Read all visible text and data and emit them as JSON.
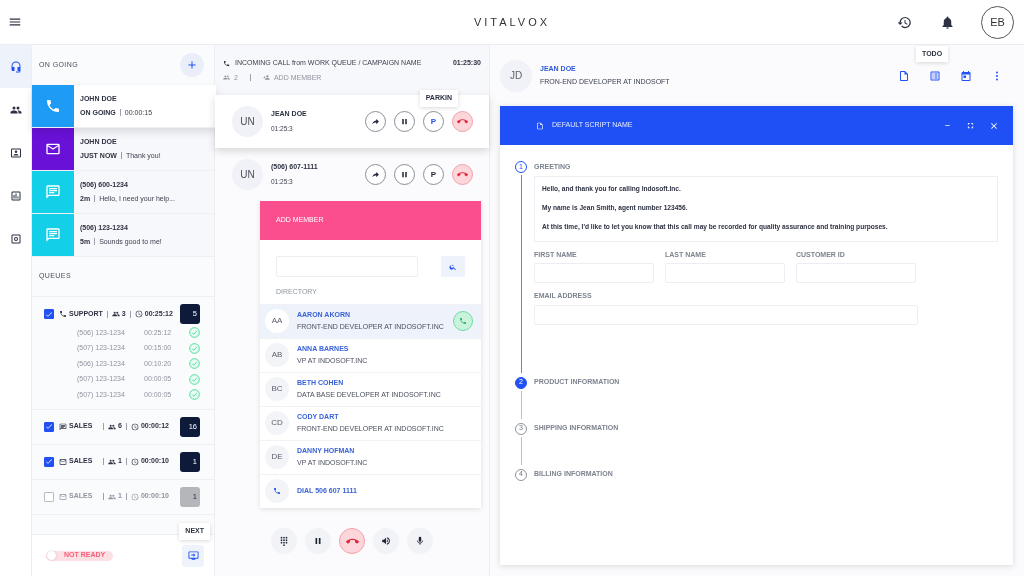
{
  "app": {
    "title": "VITALVOX",
    "avatar": "EB"
  },
  "rail": [
    {
      "selected": true
    },
    {
      "selected": false
    },
    {
      "selected": false
    },
    {
      "selected": false
    },
    {
      "selected": false
    }
  ],
  "ongoing": {
    "title": "ON GOING",
    "items": [
      {
        "kind": "call",
        "name": "JOHN DOE",
        "status": "ON GOING",
        "detail": "00:00:15",
        "color": "#1e9bf5",
        "selected": true
      },
      {
        "kind": "email",
        "name": "JOHN DOE",
        "status": "JUST NOW",
        "detail": "Thank you!",
        "color": "#6a11d8",
        "selected": false
      },
      {
        "kind": "chat",
        "name": "(506) 600-1234",
        "status": "2m",
        "detail": "Hello, I need your help...",
        "color": "#14cfe8",
        "selected": false
      },
      {
        "kind": "chat",
        "name": "(506) 123-1234",
        "status": "5m",
        "detail": "Sounds good to me!",
        "color": "#14cfe8",
        "selected": false
      }
    ]
  },
  "queues": {
    "title": "QUEUES",
    "items": [
      {
        "kind": "call",
        "name": "SUPPORT",
        "agents": "3",
        "time": "00:25:12",
        "count": "5",
        "checked": true,
        "calls": [
          {
            "number": "(506) 123-1234",
            "time": "00:25:12"
          },
          {
            "number": "(507) 123-1234",
            "time": "00:15:00"
          },
          {
            "number": "(506) 123-1234",
            "time": "00:10:20"
          },
          {
            "number": "(507) 123-1234",
            "time": "00:00:05"
          },
          {
            "number": "(507) 123-1234",
            "time": "00:00:05"
          }
        ]
      },
      {
        "kind": "chat",
        "name": "SALES",
        "agents": "6",
        "time": "00:00:12",
        "count": "16",
        "checked": true
      },
      {
        "kind": "email",
        "name": "SALES",
        "agents": "1",
        "time": "00:00:10",
        "count": "1",
        "checked": true
      },
      {
        "kind": "email",
        "name": "SALES",
        "agents": "1",
        "time": "00:00:10",
        "count": "1",
        "checked": false
      }
    ]
  },
  "footer": {
    "status": "NOT READY",
    "on": false,
    "next_tooltip": "NEXT"
  },
  "call": {
    "title": "INCOMING CALL from WORK QUEUE / CAMPAIGN NAME",
    "time": "01:25:30",
    "participants": "2",
    "add_member": "ADD MEMBER",
    "park_tooltip": "PARKIN",
    "lines": [
      {
        "avatar": "UN",
        "name": "JEAN DOE",
        "time": "01:25:3",
        "park": "P",
        "selected": true
      },
      {
        "avatar": "UN",
        "name": "(506) 607-1111",
        "time": "01:25:3",
        "park": "P",
        "selected": false
      }
    ]
  },
  "add_member": {
    "title": "ADD MEMBER",
    "directory_label": "DIRECTORY",
    "contacts": [
      {
        "initials": "AA",
        "name": "AARON AKORN",
        "role": "FRONT-END DEVELOPER AT INDOSOFT.INC",
        "selected": true
      },
      {
        "initials": "AB",
        "name": "ANNA BARNES",
        "role": "VP AT INDOSOFT.INC",
        "selected": false
      },
      {
        "initials": "BC",
        "name": "BETH COHEN",
        "role": "DATA BASE DEVELOPER AT INDOSOFT.INC",
        "selected": false
      },
      {
        "initials": "CD",
        "name": "CODY DART",
        "role": "FRONT-END DEVELOPER AT INDOSOFT.INC",
        "selected": false
      },
      {
        "initials": "DE",
        "name": "DANNY HOFMAN",
        "role": "VP AT INDOSOFT.INC",
        "selected": false
      }
    ],
    "dial": "DIAL 506 607 1111"
  },
  "contact": {
    "initials": "JD",
    "name": "JEAN DOE",
    "role": "FRON-END DEVELOPER AT INDOSOFT",
    "tooltip": "TODO"
  },
  "script": {
    "title": "DEFAULT SCRIPT NAME",
    "steps": [
      {
        "number": "1",
        "title": "GREETING",
        "expanded": true,
        "selected": false,
        "paragraphs": [
          "Hello, and thank you for calling Indosoft.Inc.",
          "My name is Jean Smith, agent number 123456.",
          "At this time, I'd like to let you know that this call may be recorded for quality assurance and training purposes."
        ],
        "fields": [
          {
            "label": "FIRST NAME",
            "kind": "short"
          },
          {
            "label": "LAST NAME",
            "kind": "short"
          },
          {
            "label": "CUSTOMER ID",
            "kind": "short"
          },
          {
            "label": "EMAIL ADDRESS",
            "kind": "wide"
          }
        ]
      },
      {
        "number": "2",
        "title": "PRODUCT INFORMATION",
        "expanded": false,
        "selected": true
      },
      {
        "number": "3",
        "title": "SHIPPING INFORMATION",
        "expanded": false,
        "selected": false
      },
      {
        "number": "4",
        "title": "BILLING INFORMATION",
        "expanded": false,
        "selected": false
      }
    ]
  }
}
